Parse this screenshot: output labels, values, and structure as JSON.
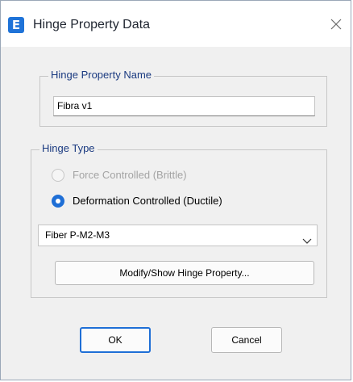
{
  "window": {
    "title": "Hinge Property Data",
    "app_icon_letter": "E",
    "icon": "close-icon"
  },
  "hinge_property_name": {
    "group_label": "Hinge Property Name",
    "value": "Fibra v1"
  },
  "hinge_type": {
    "group_label": "Hinge Type",
    "options": [
      {
        "label": "Force Controlled  (Brittle)",
        "selected": false,
        "enabled": false
      },
      {
        "label": "Deformation Controlled  (Ductile)",
        "selected": true,
        "enabled": true
      }
    ],
    "dropdown": {
      "selected": "Fiber P-M2-M3",
      "icon": "chevron-down-icon"
    },
    "modify_button_label": "Modify/Show Hinge Property..."
  },
  "actions": {
    "ok_label": "OK",
    "cancel_label": "Cancel"
  },
  "colors": {
    "accent": "#1f6fd6",
    "group_label": "#1a3a80",
    "disabled_text": "#a4a4a4"
  }
}
